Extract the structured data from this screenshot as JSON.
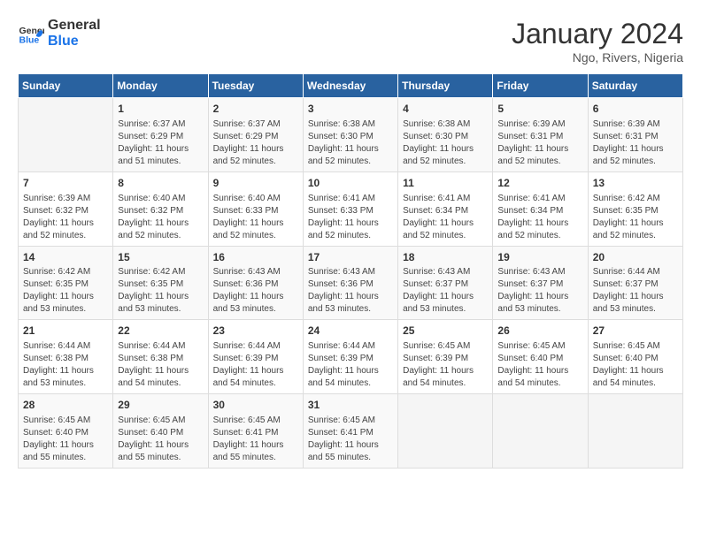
{
  "header": {
    "logo_line1": "General",
    "logo_line2": "Blue",
    "month_title": "January 2024",
    "subtitle": "Ngo, Rivers, Nigeria"
  },
  "days_of_week": [
    "Sunday",
    "Monday",
    "Tuesday",
    "Wednesday",
    "Thursday",
    "Friday",
    "Saturday"
  ],
  "weeks": [
    [
      {
        "day": "",
        "sunrise": "",
        "sunset": "",
        "daylight": ""
      },
      {
        "day": "1",
        "sunrise": "Sunrise: 6:37 AM",
        "sunset": "Sunset: 6:29 PM",
        "daylight": "Daylight: 11 hours and 51 minutes."
      },
      {
        "day": "2",
        "sunrise": "Sunrise: 6:37 AM",
        "sunset": "Sunset: 6:29 PM",
        "daylight": "Daylight: 11 hours and 52 minutes."
      },
      {
        "day": "3",
        "sunrise": "Sunrise: 6:38 AM",
        "sunset": "Sunset: 6:30 PM",
        "daylight": "Daylight: 11 hours and 52 minutes."
      },
      {
        "day": "4",
        "sunrise": "Sunrise: 6:38 AM",
        "sunset": "Sunset: 6:30 PM",
        "daylight": "Daylight: 11 hours and 52 minutes."
      },
      {
        "day": "5",
        "sunrise": "Sunrise: 6:39 AM",
        "sunset": "Sunset: 6:31 PM",
        "daylight": "Daylight: 11 hours and 52 minutes."
      },
      {
        "day": "6",
        "sunrise": "Sunrise: 6:39 AM",
        "sunset": "Sunset: 6:31 PM",
        "daylight": "Daylight: 11 hours and 52 minutes."
      }
    ],
    [
      {
        "day": "7",
        "sunrise": "Sunrise: 6:39 AM",
        "sunset": "Sunset: 6:32 PM",
        "daylight": "Daylight: 11 hours and 52 minutes."
      },
      {
        "day": "8",
        "sunrise": "Sunrise: 6:40 AM",
        "sunset": "Sunset: 6:32 PM",
        "daylight": "Daylight: 11 hours and 52 minutes."
      },
      {
        "day": "9",
        "sunrise": "Sunrise: 6:40 AM",
        "sunset": "Sunset: 6:33 PM",
        "daylight": "Daylight: 11 hours and 52 minutes."
      },
      {
        "day": "10",
        "sunrise": "Sunrise: 6:41 AM",
        "sunset": "Sunset: 6:33 PM",
        "daylight": "Daylight: 11 hours and 52 minutes."
      },
      {
        "day": "11",
        "sunrise": "Sunrise: 6:41 AM",
        "sunset": "Sunset: 6:34 PM",
        "daylight": "Daylight: 11 hours and 52 minutes."
      },
      {
        "day": "12",
        "sunrise": "Sunrise: 6:41 AM",
        "sunset": "Sunset: 6:34 PM",
        "daylight": "Daylight: 11 hours and 52 minutes."
      },
      {
        "day": "13",
        "sunrise": "Sunrise: 6:42 AM",
        "sunset": "Sunset: 6:35 PM",
        "daylight": "Daylight: 11 hours and 52 minutes."
      }
    ],
    [
      {
        "day": "14",
        "sunrise": "Sunrise: 6:42 AM",
        "sunset": "Sunset: 6:35 PM",
        "daylight": "Daylight: 11 hours and 53 minutes."
      },
      {
        "day": "15",
        "sunrise": "Sunrise: 6:42 AM",
        "sunset": "Sunset: 6:35 PM",
        "daylight": "Daylight: 11 hours and 53 minutes."
      },
      {
        "day": "16",
        "sunrise": "Sunrise: 6:43 AM",
        "sunset": "Sunset: 6:36 PM",
        "daylight": "Daylight: 11 hours and 53 minutes."
      },
      {
        "day": "17",
        "sunrise": "Sunrise: 6:43 AM",
        "sunset": "Sunset: 6:36 PM",
        "daylight": "Daylight: 11 hours and 53 minutes."
      },
      {
        "day": "18",
        "sunrise": "Sunrise: 6:43 AM",
        "sunset": "Sunset: 6:37 PM",
        "daylight": "Daylight: 11 hours and 53 minutes."
      },
      {
        "day": "19",
        "sunrise": "Sunrise: 6:43 AM",
        "sunset": "Sunset: 6:37 PM",
        "daylight": "Daylight: 11 hours and 53 minutes."
      },
      {
        "day": "20",
        "sunrise": "Sunrise: 6:44 AM",
        "sunset": "Sunset: 6:37 PM",
        "daylight": "Daylight: 11 hours and 53 minutes."
      }
    ],
    [
      {
        "day": "21",
        "sunrise": "Sunrise: 6:44 AM",
        "sunset": "Sunset: 6:38 PM",
        "daylight": "Daylight: 11 hours and 53 minutes."
      },
      {
        "day": "22",
        "sunrise": "Sunrise: 6:44 AM",
        "sunset": "Sunset: 6:38 PM",
        "daylight": "Daylight: 11 hours and 54 minutes."
      },
      {
        "day": "23",
        "sunrise": "Sunrise: 6:44 AM",
        "sunset": "Sunset: 6:39 PM",
        "daylight": "Daylight: 11 hours and 54 minutes."
      },
      {
        "day": "24",
        "sunrise": "Sunrise: 6:44 AM",
        "sunset": "Sunset: 6:39 PM",
        "daylight": "Daylight: 11 hours and 54 minutes."
      },
      {
        "day": "25",
        "sunrise": "Sunrise: 6:45 AM",
        "sunset": "Sunset: 6:39 PM",
        "daylight": "Daylight: 11 hours and 54 minutes."
      },
      {
        "day": "26",
        "sunrise": "Sunrise: 6:45 AM",
        "sunset": "Sunset: 6:40 PM",
        "daylight": "Daylight: 11 hours and 54 minutes."
      },
      {
        "day": "27",
        "sunrise": "Sunrise: 6:45 AM",
        "sunset": "Sunset: 6:40 PM",
        "daylight": "Daylight: 11 hours and 54 minutes."
      }
    ],
    [
      {
        "day": "28",
        "sunrise": "Sunrise: 6:45 AM",
        "sunset": "Sunset: 6:40 PM",
        "daylight": "Daylight: 11 hours and 55 minutes."
      },
      {
        "day": "29",
        "sunrise": "Sunrise: 6:45 AM",
        "sunset": "Sunset: 6:40 PM",
        "daylight": "Daylight: 11 hours and 55 minutes."
      },
      {
        "day": "30",
        "sunrise": "Sunrise: 6:45 AM",
        "sunset": "Sunset: 6:41 PM",
        "daylight": "Daylight: 11 hours and 55 minutes."
      },
      {
        "day": "31",
        "sunrise": "Sunrise: 6:45 AM",
        "sunset": "Sunset: 6:41 PM",
        "daylight": "Daylight: 11 hours and 55 minutes."
      },
      {
        "day": "",
        "sunrise": "",
        "sunset": "",
        "daylight": ""
      },
      {
        "day": "",
        "sunrise": "",
        "sunset": "",
        "daylight": ""
      },
      {
        "day": "",
        "sunrise": "",
        "sunset": "",
        "daylight": ""
      }
    ]
  ]
}
